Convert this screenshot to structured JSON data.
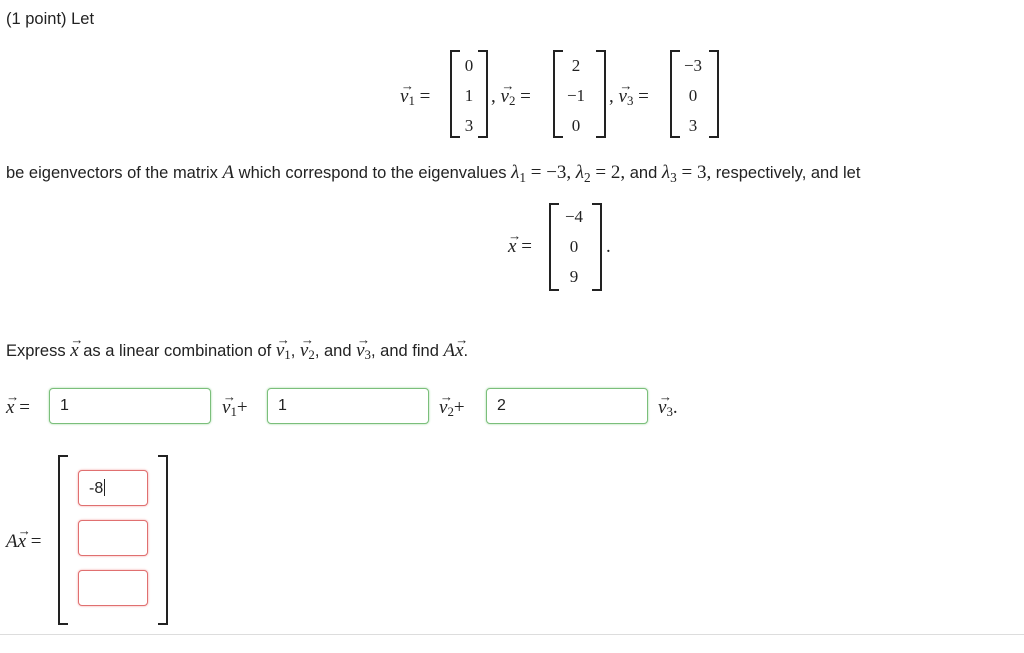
{
  "header": {
    "text": "(1 point) Let"
  },
  "vectors": [
    {
      "label": "v",
      "sub": "1",
      "values": [
        "0",
        "1",
        "3"
      ]
    },
    {
      "label": "v",
      "sub": "2",
      "values": [
        "2",
        "−1",
        "0"
      ]
    },
    {
      "label": "v",
      "sub": "3",
      "values": [
        "−3",
        "0",
        "3"
      ]
    }
  ],
  "eigen_sentence": {
    "part1": "be eigenvectors of the matrix",
    "matrix": "A",
    "part2": "which correspond to the eigenvalues",
    "l1": "λ",
    "l1_sub": "1",
    "l1_val": "= −3,",
    "l2": "λ",
    "l2_sub": "2",
    "l2_val": "= 2,",
    "and": "and",
    "l3": "λ",
    "l3_sub": "3",
    "l3_val": "= 3,",
    "part3": "respectively, and let"
  },
  "x_vector": {
    "label": "x",
    "values": [
      "−4",
      "0",
      "9"
    ]
  },
  "instruction": {
    "part1": "Express",
    "part2": "as a linear combination of",
    "part3": "and",
    "part4": ", and find",
    "ax": "Ax"
  },
  "combination": {
    "eq": "=",
    "plus": "+",
    "inputs": [
      {
        "value": "1",
        "status": "correct"
      },
      {
        "value": "1",
        "status": "correct"
      },
      {
        "value": "2",
        "status": "correct"
      }
    ]
  },
  "ax_answer": {
    "label": "A",
    "eq": "=",
    "inputs": [
      {
        "value": "-8",
        "status": "incorrect",
        "focused": true
      },
      {
        "value": "",
        "status": "incorrect"
      },
      {
        "value": "",
        "status": "incorrect"
      }
    ]
  },
  "colors": {
    "correct_border": "#7bbf7b",
    "incorrect_border": "#e07070"
  }
}
